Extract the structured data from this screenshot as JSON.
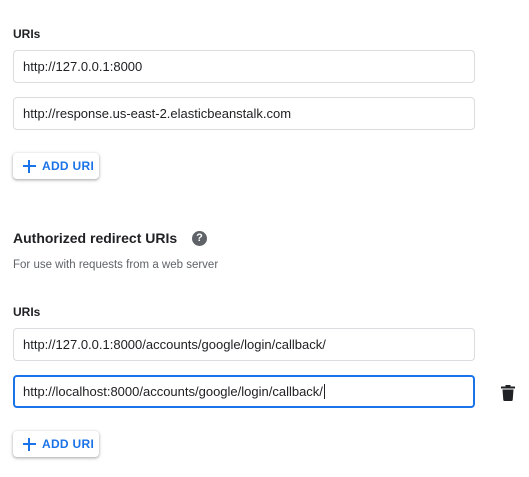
{
  "origins": {
    "uris_label": "URIs",
    "uris": [
      {
        "value": "http://127.0.0.1:8000"
      },
      {
        "value": "http://response.us-east-2.elasticbeanstalk.com"
      }
    ],
    "add_button_label": "ADD URI"
  },
  "redirects": {
    "title": "Authorized redirect URIs",
    "hint": "For use with requests from a web server",
    "uris_label": "URIs",
    "uris": [
      {
        "value": "http://127.0.0.1:8000/accounts/google/login/callback/"
      },
      {
        "value": "http://localhost:8000/accounts/google/login/callback/"
      }
    ],
    "add_button_label": "ADD URI"
  },
  "icons": {
    "help": "help-icon",
    "delete": "trash-icon",
    "add": "plus-icon"
  },
  "colors": {
    "accent": "#1a73e8",
    "border": "#dadce0",
    "text": "#202124",
    "muted": "#5f6368"
  }
}
